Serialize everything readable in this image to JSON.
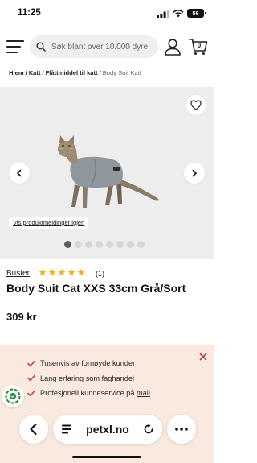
{
  "status_bar": {
    "time": "11:25",
    "battery": "56"
  },
  "header": {
    "search_placeholder": "Søk blant over 10.000 dyre",
    "cart_count": "0"
  },
  "breadcrumb": {
    "items": [
      "Hjem",
      "Katt",
      "Flåttmiddel til katt"
    ],
    "current": "Body Suit Katt"
  },
  "gallery": {
    "report_link": "Vis produktmeldinger igjen",
    "slide_count": 8,
    "active_slide": 1
  },
  "product": {
    "brand": "Buster",
    "rating": 5,
    "review_count": "(1)",
    "title": "Body Suit Cat XXS 33cm Grå/Sort",
    "price": "309 kr"
  },
  "benefits": {
    "items": [
      {
        "text": "Tusenvis av fornøyde kunder",
        "link": ""
      },
      {
        "text": "Lang erfaring som faghandel",
        "link": ""
      },
      {
        "text": "Profesjonell kundeservice på ",
        "link": "mail"
      }
    ]
  },
  "browser": {
    "url": "petxl.no"
  },
  "colors": {
    "accent": "#c0392b",
    "star": "#f2b01e",
    "benefits_bg": "#f9e9df",
    "gallery_bg": "#ededed",
    "trust_badge": "#1d8a3a"
  },
  "icons": [
    "menu-icon",
    "search-icon",
    "user-icon",
    "cart-icon",
    "heart-icon",
    "chevron-left-icon",
    "chevron-right-icon",
    "star-icon",
    "checkmark-icon",
    "close-icon",
    "trust-badge-icon",
    "reader-icon",
    "reload-icon",
    "more-icon"
  ]
}
